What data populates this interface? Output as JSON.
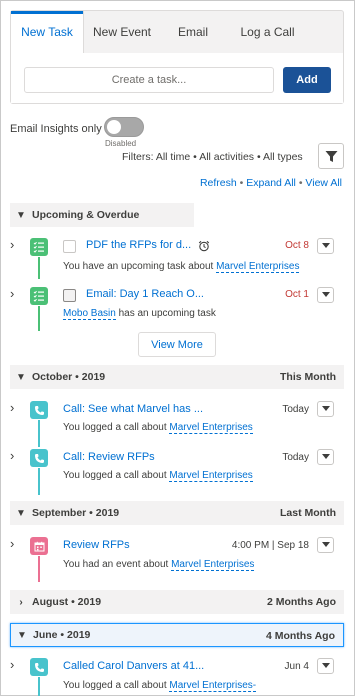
{
  "composer": {
    "tabs": [
      "New Task",
      "New Event",
      "Email",
      "Log a Call"
    ],
    "task_placeholder": "Create a task...",
    "add_label": "Add"
  },
  "insights": {
    "label": "Email Insights only",
    "state": "Disabled"
  },
  "filters": {
    "text": "Filters: All time • All activities • All types"
  },
  "links": {
    "refresh": "Refresh",
    "expand_all": "Expand All",
    "view_all": "View All",
    "sep": "•"
  },
  "sections": {
    "upcoming": {
      "label": "Upcoming & Overdue",
      "right": ""
    },
    "october": {
      "label": "October • 2019",
      "right": "This Month"
    },
    "september": {
      "label": "September • 2019",
      "right": "Last Month"
    },
    "august": {
      "label": "August • 2019",
      "right": "2 Months Ago"
    },
    "june": {
      "label": "June • 2019",
      "right": "4 Months Ago"
    }
  },
  "items": [
    {
      "icon": "task-icon",
      "title": "PDF the RFPs for d...",
      "date": "Oct 8",
      "sub_pre": "You have an upcoming task about ",
      "sub_link": "Marvel Enterprises",
      "sub_post": ""
    },
    {
      "icon": "task-icon",
      "title": "Email: Day 1 Reach O...",
      "date": "Oct 1",
      "sub_pre": "",
      "sub_link": "Mobo Basin",
      "sub_post": " has an upcoming task"
    },
    {
      "icon": "call-icon",
      "title": "Call: See what Marvel has ...",
      "date": "Today",
      "sub_pre": "You logged a call about ",
      "sub_link": "Marvel Enterprises",
      "sub_post": ""
    },
    {
      "icon": "call-icon",
      "title": "Call: Review RFPs",
      "date": "Today",
      "sub_pre": "You logged a call about ",
      "sub_link": "Marvel Enterprises",
      "sub_post": ""
    },
    {
      "icon": "event-icon",
      "title": "Review RFPs",
      "date": "4:00 PM | Sep 18",
      "sub_pre": "You had an event about ",
      "sub_link": "Marvel Enterprises",
      "sub_post": ""
    },
    {
      "icon": "call-icon",
      "title": "Called Carol Danvers at 41...",
      "date": "Jun 4",
      "sub_pre": "You logged a call about ",
      "sub_link": "Marvel Enterprises-",
      "sub_post": ""
    }
  ],
  "view_more": "View More",
  "colors": {
    "accent": "#0070d2",
    "button": "#1b5297",
    "overdue": "#c23934",
    "task": "#4bc076",
    "call": "#48c3cc",
    "event": "#eb7092"
  }
}
